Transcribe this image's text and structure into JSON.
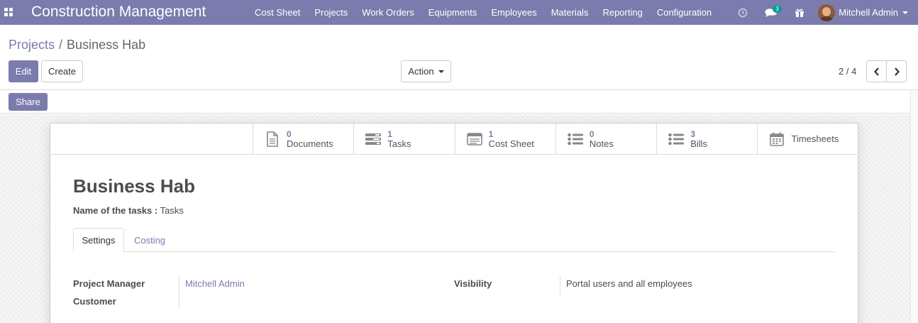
{
  "app": {
    "title": "Construction Management",
    "menu": [
      "Cost Sheet",
      "Projects",
      "Work Orders",
      "Equipments",
      "Employees",
      "Materials",
      "Reporting",
      "Configuration"
    ],
    "messages_badge": "3",
    "user_name": "Mitchell Admin",
    "accent_color": "#7c7bad"
  },
  "breadcrumb": {
    "parent": "Projects",
    "separator": "/",
    "current": "Business Hab"
  },
  "toolbar": {
    "edit_label": "Edit",
    "create_label": "Create",
    "action_label": "Action",
    "pager": "2 / 4"
  },
  "statusbar": {
    "share_label": "Share"
  },
  "smart_buttons": [
    {
      "value": "0",
      "label": "Documents",
      "icon": "document-icon"
    },
    {
      "value": "1",
      "label": "Tasks",
      "icon": "tasks-icon"
    },
    {
      "value": "1",
      "label": "Cost Sheet",
      "icon": "cost-sheet-icon"
    },
    {
      "value": "0",
      "label": "Notes",
      "icon": "list-icon"
    },
    {
      "value": "3",
      "label": "Bills",
      "icon": "list-icon"
    },
    {
      "value": "",
      "label": "Timesheets",
      "icon": "calendar-icon"
    }
  ],
  "form": {
    "title": "Business Hab",
    "tasks_label": "Name of the tasks :",
    "tasks_value": "Tasks",
    "tabs": [
      "Settings",
      "Costing"
    ],
    "fields": {
      "project_manager_label": "Project Manager",
      "project_manager_value": "Mitchell Admin",
      "customer_label": "Customer",
      "visibility_label": "Visibility",
      "visibility_value": "Portal users and all employees"
    }
  }
}
